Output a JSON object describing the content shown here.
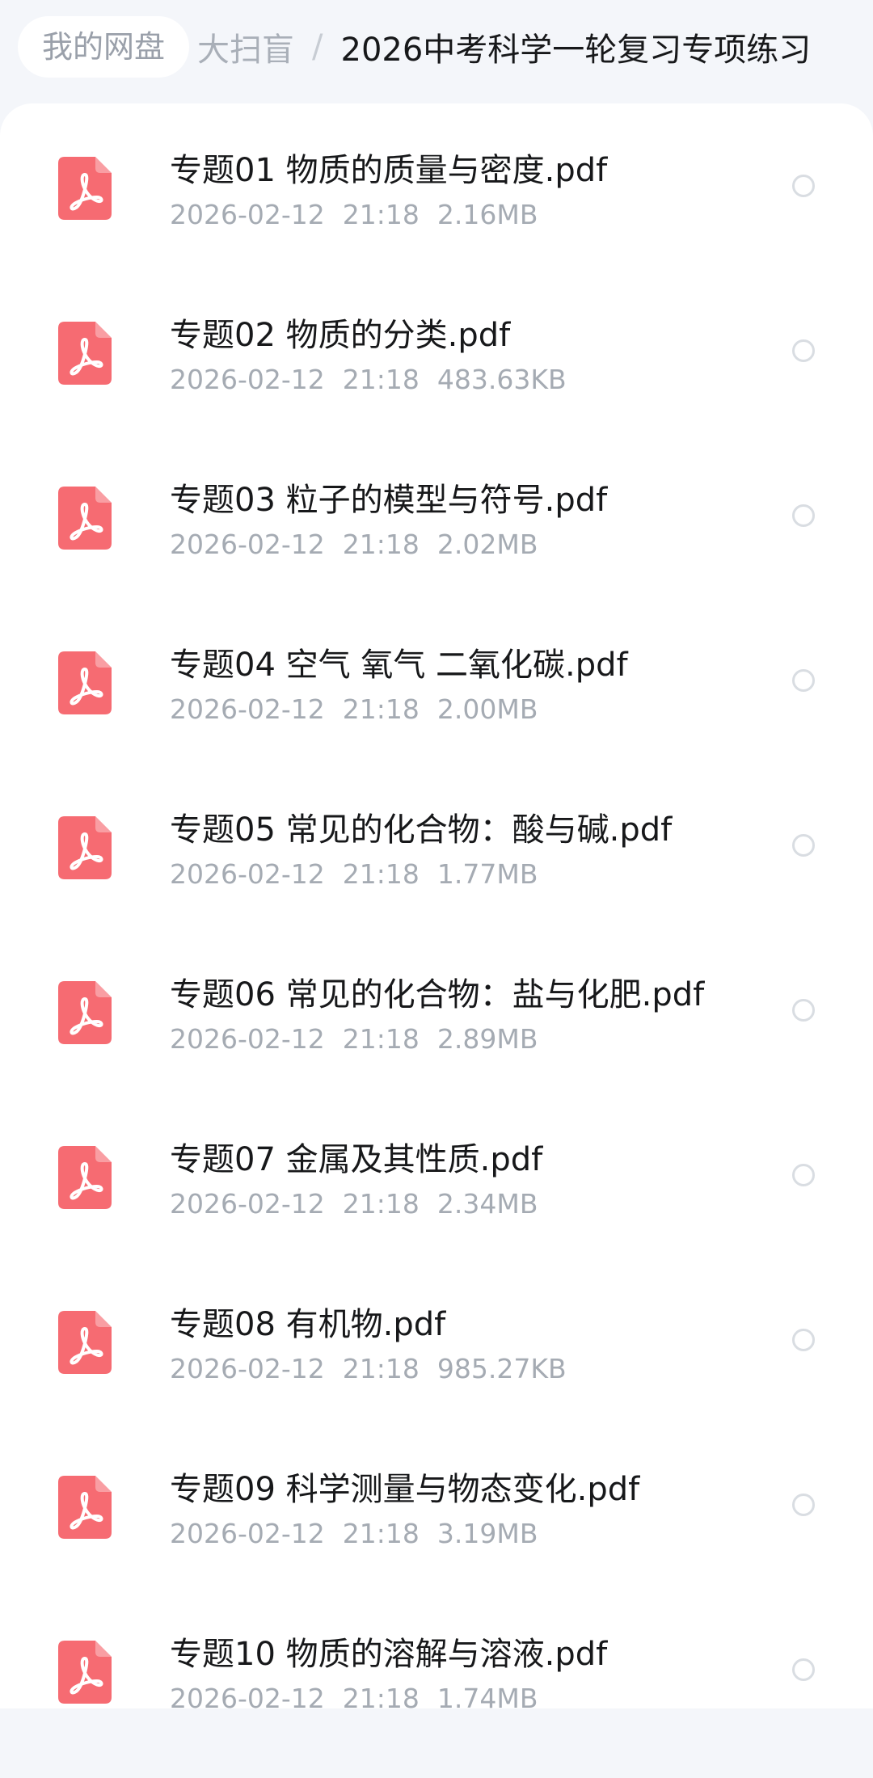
{
  "breadcrumb": {
    "root": "我的网盘",
    "middle": "大扫盲",
    "separator": "/",
    "current": "2026中考科学一轮复习专项练习"
  },
  "colors": {
    "pdf_icon": "#f66b72",
    "background": "#f4f6fa"
  },
  "files": [
    {
      "name": "专题01 物质的质量与密度.pdf",
      "date": "2026-02-12",
      "time": "21:18",
      "size": "2.16MB",
      "icon": "pdf-file-icon"
    },
    {
      "name": "专题02 物质的分类.pdf",
      "date": "2026-02-12",
      "time": "21:18",
      "size": "483.63KB",
      "icon": "pdf-file-icon"
    },
    {
      "name": "专题03 粒子的模型与符号.pdf",
      "date": "2026-02-12",
      "time": "21:18",
      "size": "2.02MB",
      "icon": "pdf-file-icon"
    },
    {
      "name": "专题04 空气 氧气 二氧化碳.pdf",
      "date": "2026-02-12",
      "time": "21:18",
      "size": "2.00MB",
      "icon": "pdf-file-icon"
    },
    {
      "name": "专题05 常见的化合物：酸与碱.pdf",
      "date": "2026-02-12",
      "time": "21:18",
      "size": "1.77MB",
      "icon": "pdf-file-icon"
    },
    {
      "name": "专题06 常见的化合物：盐与化肥.pdf",
      "date": "2026-02-12",
      "time": "21:18",
      "size": "2.89MB",
      "icon": "pdf-file-icon"
    },
    {
      "name": "专题07 金属及其性质.pdf",
      "date": "2026-02-12",
      "time": "21:18",
      "size": "2.34MB",
      "icon": "pdf-file-icon"
    },
    {
      "name": "专题08 有机物.pdf",
      "date": "2026-02-12",
      "time": "21:18",
      "size": "985.27KB",
      "icon": "pdf-file-icon"
    },
    {
      "name": "专题09 科学测量与物态变化.pdf",
      "date": "2026-02-12",
      "time": "21:18",
      "size": "3.19MB",
      "icon": "pdf-file-icon"
    },
    {
      "name": "专题10 物质的溶解与溶液.pdf",
      "date": "2026-02-12",
      "time": "21:18",
      "size": "1.74MB",
      "icon": "pdf-file-icon"
    }
  ]
}
